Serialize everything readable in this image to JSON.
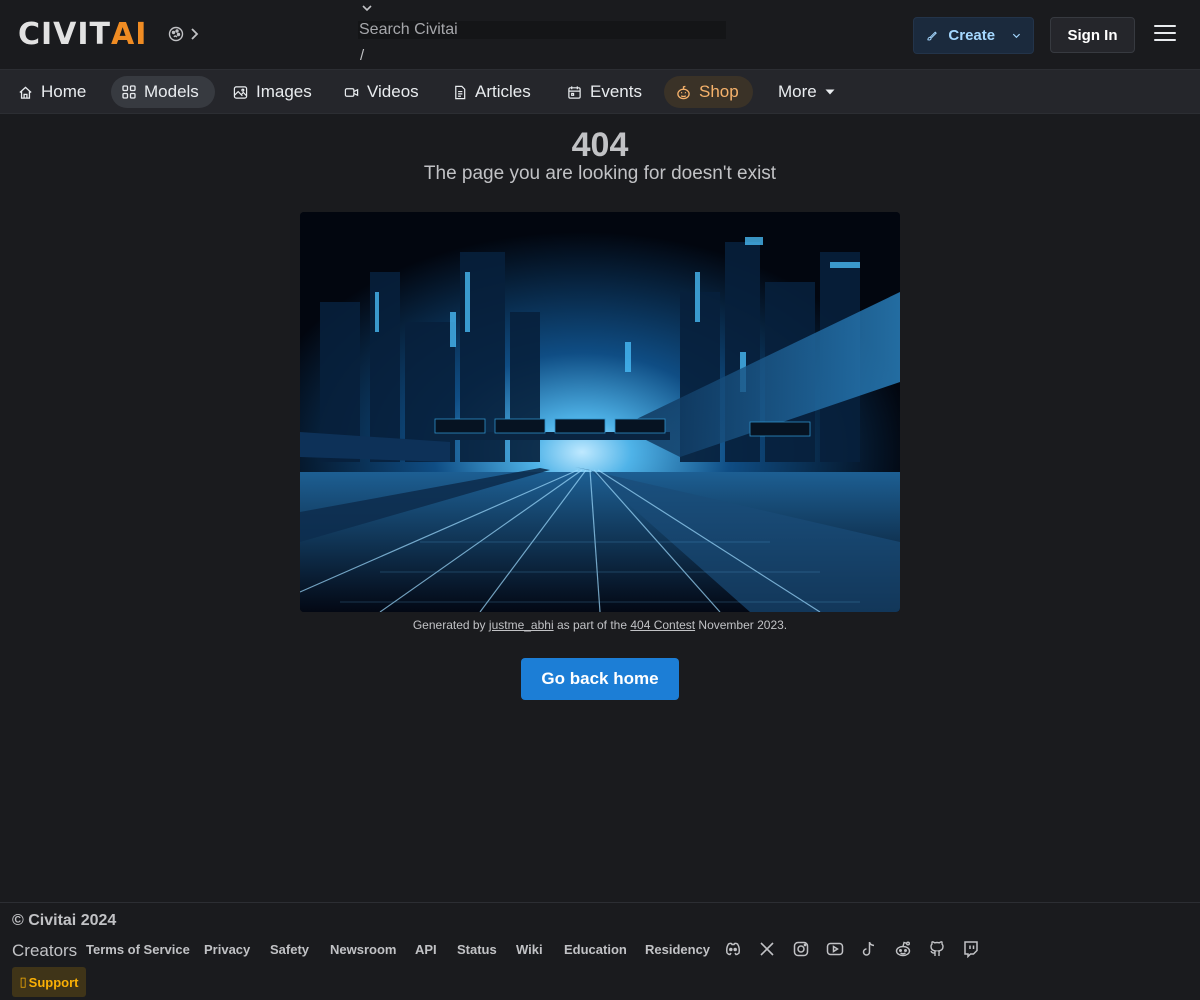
{
  "header": {
    "logo_civ": "CIVIT",
    "logo_ai": "AI",
    "search_placeholder": "Search Civitai",
    "search_hotkey": "/",
    "create_label": "Create",
    "signin_label": "Sign In"
  },
  "nav": {
    "items": [
      {
        "label": "Home",
        "icon": "home-icon"
      },
      {
        "label": "Models",
        "icon": "grid-icon",
        "active": true
      },
      {
        "label": "Images",
        "icon": "photo-icon"
      },
      {
        "label": "Videos",
        "icon": "video-icon"
      },
      {
        "label": "Articles",
        "icon": "file-text-icon"
      },
      {
        "label": "Events",
        "icon": "calendar-icon"
      },
      {
        "label": "Shop",
        "icon": "pumpkin-icon"
      },
      {
        "label": "More",
        "icon": "caret-down-icon"
      }
    ]
  },
  "main": {
    "error_code": "404",
    "error_message": "The page you are looking for doesn't exist",
    "caption_prefix": "Generated by",
    "caption_user": "justme_abhi",
    "caption_middle": "as part of the",
    "caption_contest": "404 Contest",
    "caption_suffix": "November 2023.",
    "home_button": "Go back home"
  },
  "footer": {
    "copyright": "© Civitai 2024",
    "creators": "Creators",
    "links": [
      "Terms of Service",
      "Privacy",
      "Safety",
      "Newsroom",
      "API",
      "Status",
      "Wiki",
      "Education",
      "Residency"
    ],
    "social": [
      "discord-icon",
      "x-icon",
      "instagram-icon",
      "youtube-icon",
      "tiktok-icon",
      "reddit-icon",
      "github-icon",
      "twitch-icon"
    ],
    "support_label": "Support",
    "support_glyph": "▯"
  },
  "colors": {
    "background": "#1a1b1e",
    "brand_orange": "#f08c23",
    "primary_blue": "#1c7ed6",
    "shop_accent": "#f6b26b"
  }
}
